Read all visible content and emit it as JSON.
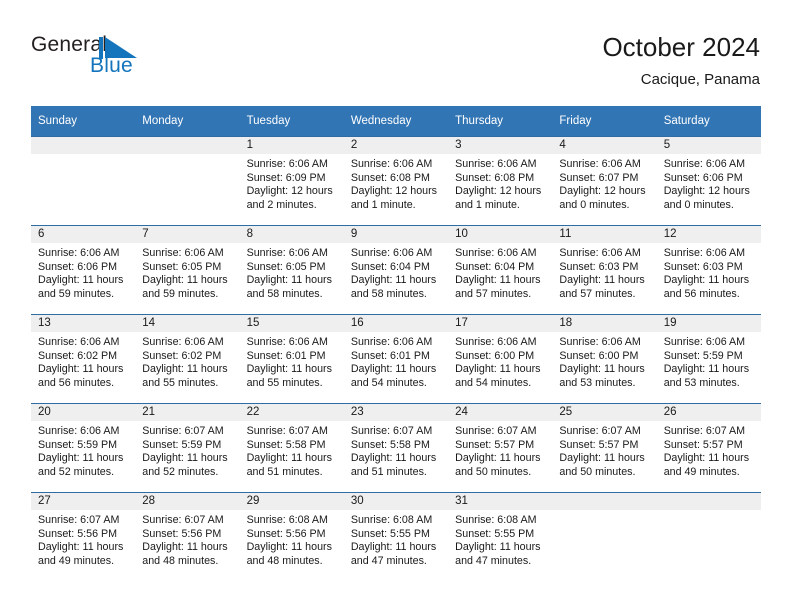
{
  "brand": {
    "name_part1": "General",
    "name_part2": "Blue",
    "logo_icon": "blue-triangle-flag-icon",
    "color_text": "#231f20",
    "color_blue": "#1474bc"
  },
  "header": {
    "title": "October 2024",
    "subtitle": "Cacique, Panama"
  },
  "theme": {
    "header_blue": "#3275b5",
    "row_divider_blue": "#2e6da4",
    "daynum_bg": "#efefef"
  },
  "weekdays": [
    "Sunday",
    "Monday",
    "Tuesday",
    "Wednesday",
    "Thursday",
    "Friday",
    "Saturday"
  ],
  "weeks": [
    [
      {
        "day": "",
        "sunrise": "",
        "sunset": "",
        "daylight_line1": "",
        "daylight_line2": ""
      },
      {
        "day": "",
        "sunrise": "",
        "sunset": "",
        "daylight_line1": "",
        "daylight_line2": ""
      },
      {
        "day": "1",
        "sunrise": "Sunrise: 6:06 AM",
        "sunset": "Sunset: 6:09 PM",
        "daylight_line1": "Daylight: 12 hours",
        "daylight_line2": "and 2 minutes."
      },
      {
        "day": "2",
        "sunrise": "Sunrise: 6:06 AM",
        "sunset": "Sunset: 6:08 PM",
        "daylight_line1": "Daylight: 12 hours",
        "daylight_line2": "and 1 minute."
      },
      {
        "day": "3",
        "sunrise": "Sunrise: 6:06 AM",
        "sunset": "Sunset: 6:08 PM",
        "daylight_line1": "Daylight: 12 hours",
        "daylight_line2": "and 1 minute."
      },
      {
        "day": "4",
        "sunrise": "Sunrise: 6:06 AM",
        "sunset": "Sunset: 6:07 PM",
        "daylight_line1": "Daylight: 12 hours",
        "daylight_line2": "and 0 minutes."
      },
      {
        "day": "5",
        "sunrise": "Sunrise: 6:06 AM",
        "sunset": "Sunset: 6:06 PM",
        "daylight_line1": "Daylight: 12 hours",
        "daylight_line2": "and 0 minutes."
      }
    ],
    [
      {
        "day": "6",
        "sunrise": "Sunrise: 6:06 AM",
        "sunset": "Sunset: 6:06 PM",
        "daylight_line1": "Daylight: 11 hours",
        "daylight_line2": "and 59 minutes."
      },
      {
        "day": "7",
        "sunrise": "Sunrise: 6:06 AM",
        "sunset": "Sunset: 6:05 PM",
        "daylight_line1": "Daylight: 11 hours",
        "daylight_line2": "and 59 minutes."
      },
      {
        "day": "8",
        "sunrise": "Sunrise: 6:06 AM",
        "sunset": "Sunset: 6:05 PM",
        "daylight_line1": "Daylight: 11 hours",
        "daylight_line2": "and 58 minutes."
      },
      {
        "day": "9",
        "sunrise": "Sunrise: 6:06 AM",
        "sunset": "Sunset: 6:04 PM",
        "daylight_line1": "Daylight: 11 hours",
        "daylight_line2": "and 58 minutes."
      },
      {
        "day": "10",
        "sunrise": "Sunrise: 6:06 AM",
        "sunset": "Sunset: 6:04 PM",
        "daylight_line1": "Daylight: 11 hours",
        "daylight_line2": "and 57 minutes."
      },
      {
        "day": "11",
        "sunrise": "Sunrise: 6:06 AM",
        "sunset": "Sunset: 6:03 PM",
        "daylight_line1": "Daylight: 11 hours",
        "daylight_line2": "and 57 minutes."
      },
      {
        "day": "12",
        "sunrise": "Sunrise: 6:06 AM",
        "sunset": "Sunset: 6:03 PM",
        "daylight_line1": "Daylight: 11 hours",
        "daylight_line2": "and 56 minutes."
      }
    ],
    [
      {
        "day": "13",
        "sunrise": "Sunrise: 6:06 AM",
        "sunset": "Sunset: 6:02 PM",
        "daylight_line1": "Daylight: 11 hours",
        "daylight_line2": "and 56 minutes."
      },
      {
        "day": "14",
        "sunrise": "Sunrise: 6:06 AM",
        "sunset": "Sunset: 6:02 PM",
        "daylight_line1": "Daylight: 11 hours",
        "daylight_line2": "and 55 minutes."
      },
      {
        "day": "15",
        "sunrise": "Sunrise: 6:06 AM",
        "sunset": "Sunset: 6:01 PM",
        "daylight_line1": "Daylight: 11 hours",
        "daylight_line2": "and 55 minutes."
      },
      {
        "day": "16",
        "sunrise": "Sunrise: 6:06 AM",
        "sunset": "Sunset: 6:01 PM",
        "daylight_line1": "Daylight: 11 hours",
        "daylight_line2": "and 54 minutes."
      },
      {
        "day": "17",
        "sunrise": "Sunrise: 6:06 AM",
        "sunset": "Sunset: 6:00 PM",
        "daylight_line1": "Daylight: 11 hours",
        "daylight_line2": "and 54 minutes."
      },
      {
        "day": "18",
        "sunrise": "Sunrise: 6:06 AM",
        "sunset": "Sunset: 6:00 PM",
        "daylight_line1": "Daylight: 11 hours",
        "daylight_line2": "and 53 minutes."
      },
      {
        "day": "19",
        "sunrise": "Sunrise: 6:06 AM",
        "sunset": "Sunset: 5:59 PM",
        "daylight_line1": "Daylight: 11 hours",
        "daylight_line2": "and 53 minutes."
      }
    ],
    [
      {
        "day": "20",
        "sunrise": "Sunrise: 6:06 AM",
        "sunset": "Sunset: 5:59 PM",
        "daylight_line1": "Daylight: 11 hours",
        "daylight_line2": "and 52 minutes."
      },
      {
        "day": "21",
        "sunrise": "Sunrise: 6:07 AM",
        "sunset": "Sunset: 5:59 PM",
        "daylight_line1": "Daylight: 11 hours",
        "daylight_line2": "and 52 minutes."
      },
      {
        "day": "22",
        "sunrise": "Sunrise: 6:07 AM",
        "sunset": "Sunset: 5:58 PM",
        "daylight_line1": "Daylight: 11 hours",
        "daylight_line2": "and 51 minutes."
      },
      {
        "day": "23",
        "sunrise": "Sunrise: 6:07 AM",
        "sunset": "Sunset: 5:58 PM",
        "daylight_line1": "Daylight: 11 hours",
        "daylight_line2": "and 51 minutes."
      },
      {
        "day": "24",
        "sunrise": "Sunrise: 6:07 AM",
        "sunset": "Sunset: 5:57 PM",
        "daylight_line1": "Daylight: 11 hours",
        "daylight_line2": "and 50 minutes."
      },
      {
        "day": "25",
        "sunrise": "Sunrise: 6:07 AM",
        "sunset": "Sunset: 5:57 PM",
        "daylight_line1": "Daylight: 11 hours",
        "daylight_line2": "and 50 minutes."
      },
      {
        "day": "26",
        "sunrise": "Sunrise: 6:07 AM",
        "sunset": "Sunset: 5:57 PM",
        "daylight_line1": "Daylight: 11 hours",
        "daylight_line2": "and 49 minutes."
      }
    ],
    [
      {
        "day": "27",
        "sunrise": "Sunrise: 6:07 AM",
        "sunset": "Sunset: 5:56 PM",
        "daylight_line1": "Daylight: 11 hours",
        "daylight_line2": "and 49 minutes."
      },
      {
        "day": "28",
        "sunrise": "Sunrise: 6:07 AM",
        "sunset": "Sunset: 5:56 PM",
        "daylight_line1": "Daylight: 11 hours",
        "daylight_line2": "and 48 minutes."
      },
      {
        "day": "29",
        "sunrise": "Sunrise: 6:08 AM",
        "sunset": "Sunset: 5:56 PM",
        "daylight_line1": "Daylight: 11 hours",
        "daylight_line2": "and 48 minutes."
      },
      {
        "day": "30",
        "sunrise": "Sunrise: 6:08 AM",
        "sunset": "Sunset: 5:55 PM",
        "daylight_line1": "Daylight: 11 hours",
        "daylight_line2": "and 47 minutes."
      },
      {
        "day": "31",
        "sunrise": "Sunrise: 6:08 AM",
        "sunset": "Sunset: 5:55 PM",
        "daylight_line1": "Daylight: 11 hours",
        "daylight_line2": "and 47 minutes."
      },
      {
        "day": "",
        "sunrise": "",
        "sunset": "",
        "daylight_line1": "",
        "daylight_line2": ""
      },
      {
        "day": "",
        "sunrise": "",
        "sunset": "",
        "daylight_line1": "",
        "daylight_line2": ""
      }
    ]
  ]
}
